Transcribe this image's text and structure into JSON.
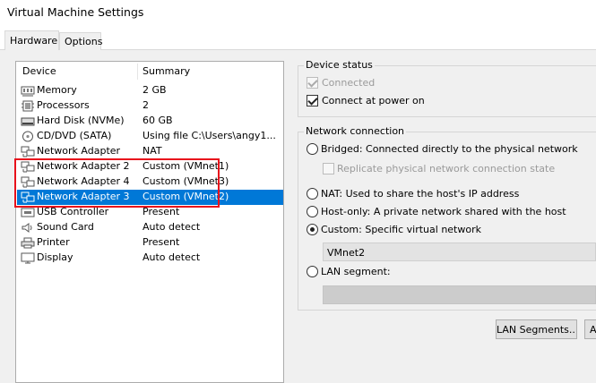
{
  "window": {
    "title": "Virtual Machine Settings"
  },
  "tabs": [
    {
      "label": "Hardware",
      "active": true
    },
    {
      "label": "Options",
      "active": false
    }
  ],
  "device_list": {
    "columns": [
      "Device",
      "Summary"
    ],
    "rows": [
      {
        "icon": "memory-icon",
        "device": "Memory",
        "summary": "2 GB",
        "selected": false
      },
      {
        "icon": "processor-icon",
        "device": "Processors",
        "summary": "2",
        "selected": false
      },
      {
        "icon": "hard-disk-icon",
        "device": "Hard Disk (NVMe)",
        "summary": "60 GB",
        "selected": false
      },
      {
        "icon": "cd-dvd-icon",
        "device": "CD/DVD (SATA)",
        "summary": "Using file C:\\Users\\angy1...",
        "selected": false
      },
      {
        "icon": "network-adapter-icon",
        "device": "Network Adapter",
        "summary": "NAT",
        "selected": false
      },
      {
        "icon": "network-adapter-icon",
        "device": "Network Adapter 2",
        "summary": "Custom (VMnet1)",
        "selected": false
      },
      {
        "icon": "network-adapter-icon",
        "device": "Network Adapter 4",
        "summary": "Custom (VMnet3)",
        "selected": false
      },
      {
        "icon": "network-adapter-icon",
        "device": "Network Adapter 3",
        "summary": "Custom (VMnet2)",
        "selected": true
      },
      {
        "icon": "usb-controller-icon",
        "device": "USB Controller",
        "summary": "Present",
        "selected": false
      },
      {
        "icon": "sound-card-icon",
        "device": "Sound Card",
        "summary": "Auto detect",
        "selected": false
      },
      {
        "icon": "printer-icon",
        "device": "Printer",
        "summary": "Present",
        "selected": false
      },
      {
        "icon": "display-icon",
        "device": "Display",
        "summary": "Auto detect",
        "selected": false
      }
    ]
  },
  "device_status": {
    "title": "Device status",
    "connected": {
      "label": "Connected",
      "checked": true,
      "enabled": false
    },
    "connect_at_power_on": {
      "label": "Connect at power on",
      "checked": true,
      "enabled": true
    }
  },
  "network_connection": {
    "title": "Network connection",
    "bridged": {
      "label": "Bridged: Connected directly to the physical network",
      "selected": false
    },
    "replicate": {
      "label": "Replicate physical network connection state",
      "checked": false,
      "enabled": false
    },
    "nat": {
      "label": "NAT: Used to share the host's IP address",
      "selected": false
    },
    "host_only": {
      "label": "Host-only: A private network shared with the host",
      "selected": false
    },
    "custom": {
      "label": "Custom: Specific virtual network",
      "selected": true
    },
    "custom_network_value": "VMnet2",
    "lan_segment": {
      "label": "LAN segment:",
      "selected": false
    }
  },
  "buttons": {
    "lan_segments": "LAN Segments...",
    "advanced": "A"
  },
  "colors": {
    "selection": "#0078d7",
    "highlight_box": "#e8121c",
    "dialog_background": "#f0f0f0"
  }
}
